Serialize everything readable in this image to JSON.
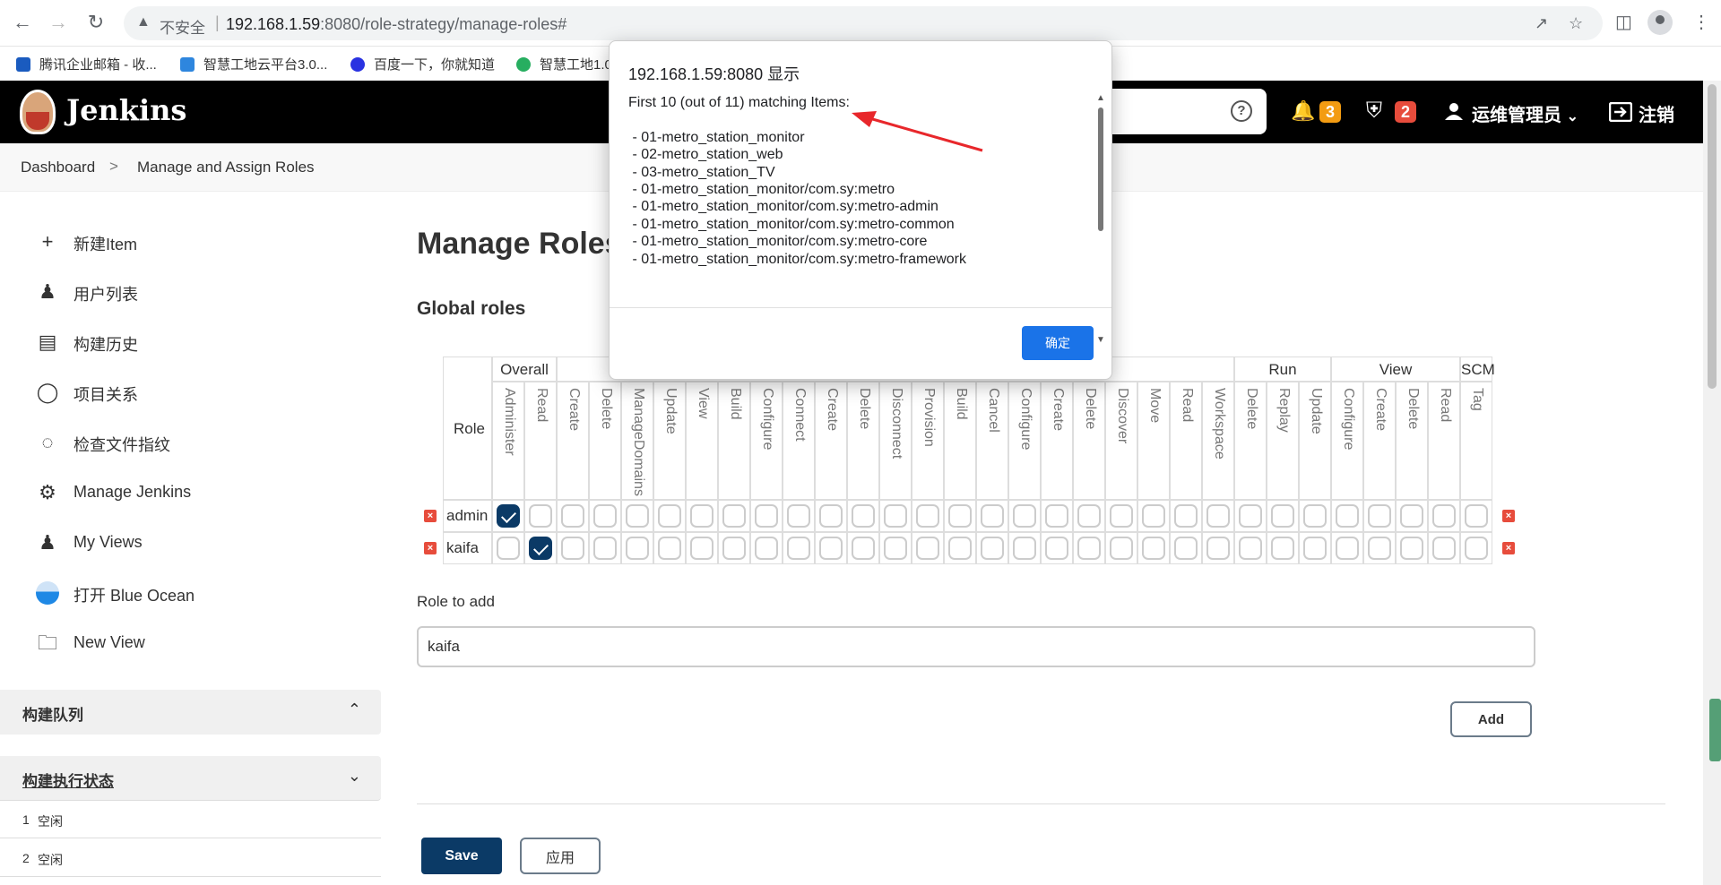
{
  "browser": {
    "insecure_label": "不安全",
    "url_host": "192.168.1.59",
    "url_path": ":8080/role-strategy/manage-roles#",
    "bookmarks": [
      "腾讯企业邮箱 - 收...",
      "智慧工地云平台3.0...",
      "百度一下，你就知道",
      "智慧工地1.0"
    ]
  },
  "header": {
    "title": "Jenkins",
    "notifications_count": "3",
    "security_count": "2",
    "user_name": "运维管理员",
    "logout_label": "注销",
    "help_glyph": "?"
  },
  "breadcrumb": {
    "items": [
      "Dashboard",
      "Manage and Assign Roles"
    ],
    "separator": ">"
  },
  "sidebar": {
    "items": [
      {
        "label": "新建Item",
        "icon": "plus-icon"
      },
      {
        "label": "用户列表",
        "icon": "users-icon"
      },
      {
        "label": "构建历史",
        "icon": "history-icon"
      },
      {
        "label": "项目关系",
        "icon": "relationship-icon"
      },
      {
        "label": "检查文件指纹",
        "icon": "fingerprint-icon"
      },
      {
        "label": "Manage Jenkins",
        "icon": "gear-icon"
      },
      {
        "label": "My Views",
        "icon": "users-icon"
      },
      {
        "label": "打开 Blue Ocean",
        "icon": "blue-ocean-icon"
      },
      {
        "label": "New View",
        "icon": "folder-icon"
      }
    ],
    "build_queue_title": "构建队列",
    "executor_title": "构建执行状态",
    "executors": [
      {
        "num": "1",
        "state": "空闲"
      },
      {
        "num": "2",
        "state": "空闲"
      }
    ]
  },
  "main": {
    "title": "Manage Roles",
    "global_roles_title": "Global roles",
    "role_header": "Role",
    "groups": [
      "Overall",
      "Run",
      "View",
      "SCM"
    ],
    "permissions": [
      "Administer",
      "Read",
      "Create",
      "Delete",
      "ManageDomains",
      "Update",
      "View",
      "Build",
      "Configure",
      "Connect",
      "Create",
      "Delete",
      "Disconnect",
      "Provision",
      "Build",
      "Cancel",
      "Configure",
      "Create",
      "Delete",
      "Discover",
      "Move",
      "Read",
      "Workspace",
      "Delete",
      "Replay",
      "Update",
      "Configure",
      "Create",
      "Delete",
      "Read",
      "Tag"
    ],
    "roles": [
      {
        "name": "admin",
        "checked": [
          0
        ]
      },
      {
        "name": "kaifa",
        "checked": [
          1
        ]
      }
    ],
    "role_to_add_label": "Role to add",
    "role_to_add_value": "kaifa",
    "add_label": "Add",
    "save_label": "Save",
    "apply_label": "应用"
  },
  "dialog": {
    "title": "192.168.1.59:8080 显示",
    "lines": [
      "First 10 (out of 11) matching Items:",
      "",
      " - 01-metro_station_monitor",
      " - 02-metro_station_web",
      " - 03-metro_station_TV",
      " - 01-metro_station_monitor/com.sy:metro",
      " - 01-metro_station_monitor/com.sy:metro-admin",
      " - 01-metro_station_monitor/com.sy:metro-common",
      " - 01-metro_station_monitor/com.sy:metro-core",
      " - 01-metro_station_monitor/com.sy:metro-framework"
    ],
    "ok_label": "确定"
  },
  "colors": {
    "jenkins_header": "#000000",
    "notification_badge": "#f39c12",
    "security_badge": "#e74c3c",
    "primary_button": "#0b3a66",
    "dialog_ok": "#1a73e8",
    "annotation_arrow": "#e8272b"
  }
}
